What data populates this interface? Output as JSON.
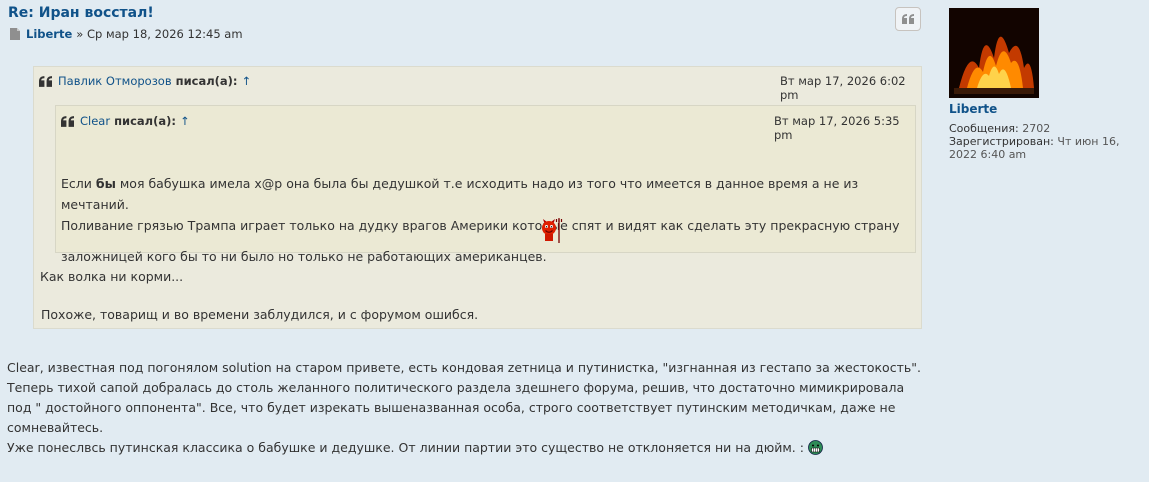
{
  "post": {
    "title": "Re: Иран восстал!",
    "author": "Liberte",
    "date": "» Ср мар 18, 2026 12:45 am",
    "quote_button_icon": "quote-icon"
  },
  "outer_quote": {
    "name": "Павлик Отморозов",
    "said": "писал(а):",
    "arrow": "↑",
    "date": "Вт мар 17, 2026 6:02 pm",
    "line1": "Как волка ни корми...",
    "line2": "Похоже, товарищ и во времени заблудился, и с форумом ошибся."
  },
  "inner_quote": {
    "name": "Clear",
    "said": "писал(а):",
    "arrow": "↑",
    "date": "Вт мар 17, 2026 5:35 pm",
    "text_before_bold": "Если ",
    "bold": "бы",
    "text_rest": " моя бабушка имела х@р она была бы дедушкой т.е исходить надо из того что имеется в данное время а не из мечтаний.",
    "line2": "Поливание грязью Трампа играет только на дудку врагов Америки которые спят и видят как сделать эту прекрасную страну",
    "line3": "заложницей кого бы то ни было но только не работающих американцев.",
    "smiley": "devil-smiley-icon"
  },
  "reply": {
    "line1": "Clear, известная под погонялом solution на старом привете, есть кондовая zетница и путинистка, \"изгнанная из гестапо за жестокость\".",
    "line2": "Теперь тихой сапой добралась до столь желанного политического раздела здешнего форума, решив, что достаточно мимикрировала",
    "line3": "под \" достойного оппонента\". Все, что будет изрекать вышеназванная особа, строго соответствует путинским методичкам, даже не",
    "line4": "сомневайтесь.",
    "line5": "Уже понеслвсь путинская классика о бабушке и дедушке. От линии партии это существо не отклоняется ни на дюйм. :",
    "smiley": "grin-smiley-icon"
  },
  "profile": {
    "name": "Liberte",
    "posts_label": "Сообщения:",
    "posts_value": "2702",
    "registered_label": "Зарегистрирован:",
    "registered_value_1": "Чт июн 16,",
    "registered_value_2": "2022 6:40 am"
  },
  "colors": {
    "background": "#e1ebf2",
    "link": "#105289",
    "quote_bg": "#ebeadd"
  }
}
